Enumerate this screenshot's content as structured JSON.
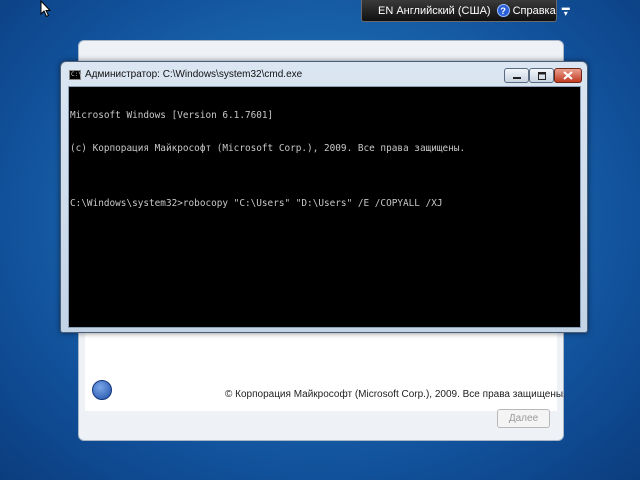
{
  "langbar": {
    "language": "EN Английский (США)",
    "help_label": "Справка",
    "help_icon": "?",
    "menu_glyph": "▬\n▾"
  },
  "setup": {
    "copyright": "© Корпорация Майкрософт (Microsoft Corp.), 2009. Все права защищены.",
    "next_button": "Далее"
  },
  "cmd": {
    "title": "Администратор: C:\\Windows\\system32\\cmd.exe",
    "icon_text": "C:\\",
    "lines": [
      "Microsoft Windows [Version 6.1.7601]",
      "(c) Корпорация Майкрософт (Microsoft Corp.), 2009. Все права защищены.",
      "",
      "C:\\Windows\\system32>robocopy \"C:\\Users\" \"D:\\Users\" /E /COPYALL /XJ"
    ]
  },
  "colors": {
    "desktop": "#1c6db3",
    "console_bg": "#000000",
    "console_text": "#c8c8c8",
    "close_button": "#c23b22"
  },
  "icons": {
    "help": "help-icon",
    "cursor": "cursor-arrow-icon",
    "cmd": "cmd-icon",
    "minimize": "minimize-icon",
    "maximize": "maximize-icon",
    "close": "close-icon",
    "setup_logo": "windows-setup-icon"
  }
}
